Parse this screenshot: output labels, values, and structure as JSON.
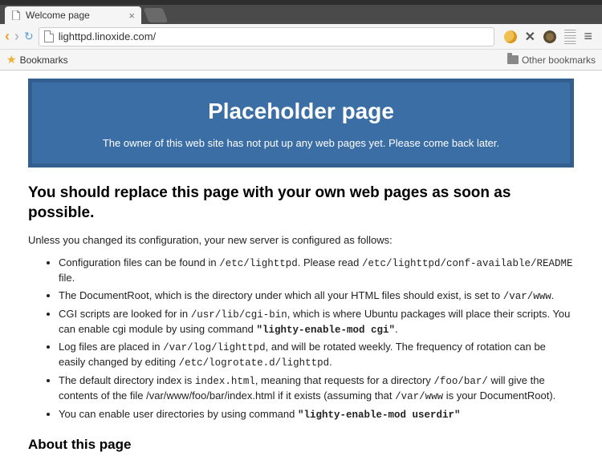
{
  "titlebar": {
    "right": ""
  },
  "tab": {
    "title": "Welcome page"
  },
  "nav": {
    "url": "lighttpd.linoxide.com/"
  },
  "bookmarks": {
    "label": "Bookmarks",
    "other": "Other bookmarks"
  },
  "page": {
    "banner_title": "Placeholder page",
    "banner_sub": "The owner of this web site has not put up any web pages yet. Please come back later.",
    "h2": "You should replace this page with your own web pages as soon as possible.",
    "intro": "Unless you changed its configuration, your new server is configured as follows:",
    "items": [
      {
        "pre1": "Configuration files can be found in ",
        "code1": "/etc/lighttpd",
        "mid1": ". Please read ",
        "code2": "/etc/lighttpd/conf-available/README",
        "post": " file."
      },
      {
        "pre1": "The DocumentRoot, which is the directory under which all your HTML files should exist, is set to ",
        "code1": "/var/www",
        "post": "."
      },
      {
        "pre1": "CGI scripts are looked for in ",
        "code1": "/usr/lib/cgi-bin",
        "mid1": ", which is where Ubuntu packages will place their scripts. You can enable cgi module by using command ",
        "strong": "\"lighty-enable-mod cgi\"",
        "post": "."
      },
      {
        "pre1": "Log files are placed in ",
        "code1": "/var/log/lighttpd",
        "mid1": ", and will be rotated weekly. The frequency of rotation can be easily changed by editing ",
        "code2": "/etc/logrotate.d/lighttpd",
        "post": "."
      },
      {
        "pre1": "The default directory index is ",
        "code1": "index.html",
        "mid1": ", meaning that requests for a directory ",
        "code2": "/foo/bar/",
        "mid2": " will give the contents of the file /var/www/foo/bar/index.html if it exists (assuming that ",
        "code3": "/var/www",
        "post": " is your DocumentRoot)."
      },
      {
        "pre1": "You can enable user directories by using command ",
        "strong": "\"lighty-enable-mod userdir\"",
        "post": ""
      }
    ],
    "about_h": "About this page"
  }
}
